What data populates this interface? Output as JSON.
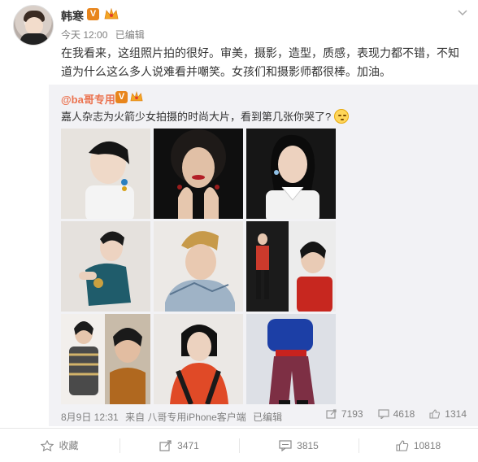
{
  "user": {
    "name": "韩寒",
    "v_badge": "V",
    "time": "今天 12:00",
    "edited": "已编辑"
  },
  "post": {
    "text": "在我看来，这组照片拍的很好。审美，摄影，造型，质感，表现力都不错，不知道为什么这么多人说难看并嘲笑。女孩们和摄影师都很棒。加油。"
  },
  "repost": {
    "user": "@ba哥专用",
    "v_badge": "V",
    "text": "嘉人杂志为火箭少女拍摄的时尚大片，看到第几张你哭了?",
    "date": "8月9日 12:31",
    "source": "来自 八哥专用iPhone客户端",
    "edited": "已编辑",
    "stats": {
      "reposts": "7193",
      "comments": "4618",
      "likes": "1314"
    },
    "photos": [
      "photo-1",
      "photo-2",
      "photo-3",
      "photo-4",
      "photo-5",
      "photo-6",
      "photo-7",
      "photo-8",
      "photo-9"
    ]
  },
  "actions": {
    "favorite": "收藏",
    "repost": "3471",
    "comment": "3815",
    "like": "10818"
  },
  "colors": {
    "accent": "#eb7350",
    "badge": "#e8851c",
    "repost_bg": "#f2f2f5"
  },
  "icons": [
    "chevron-down-icon",
    "crown-icon",
    "emoji-icon",
    "repost-icon",
    "comment-icon",
    "like-icon",
    "star-icon"
  ]
}
